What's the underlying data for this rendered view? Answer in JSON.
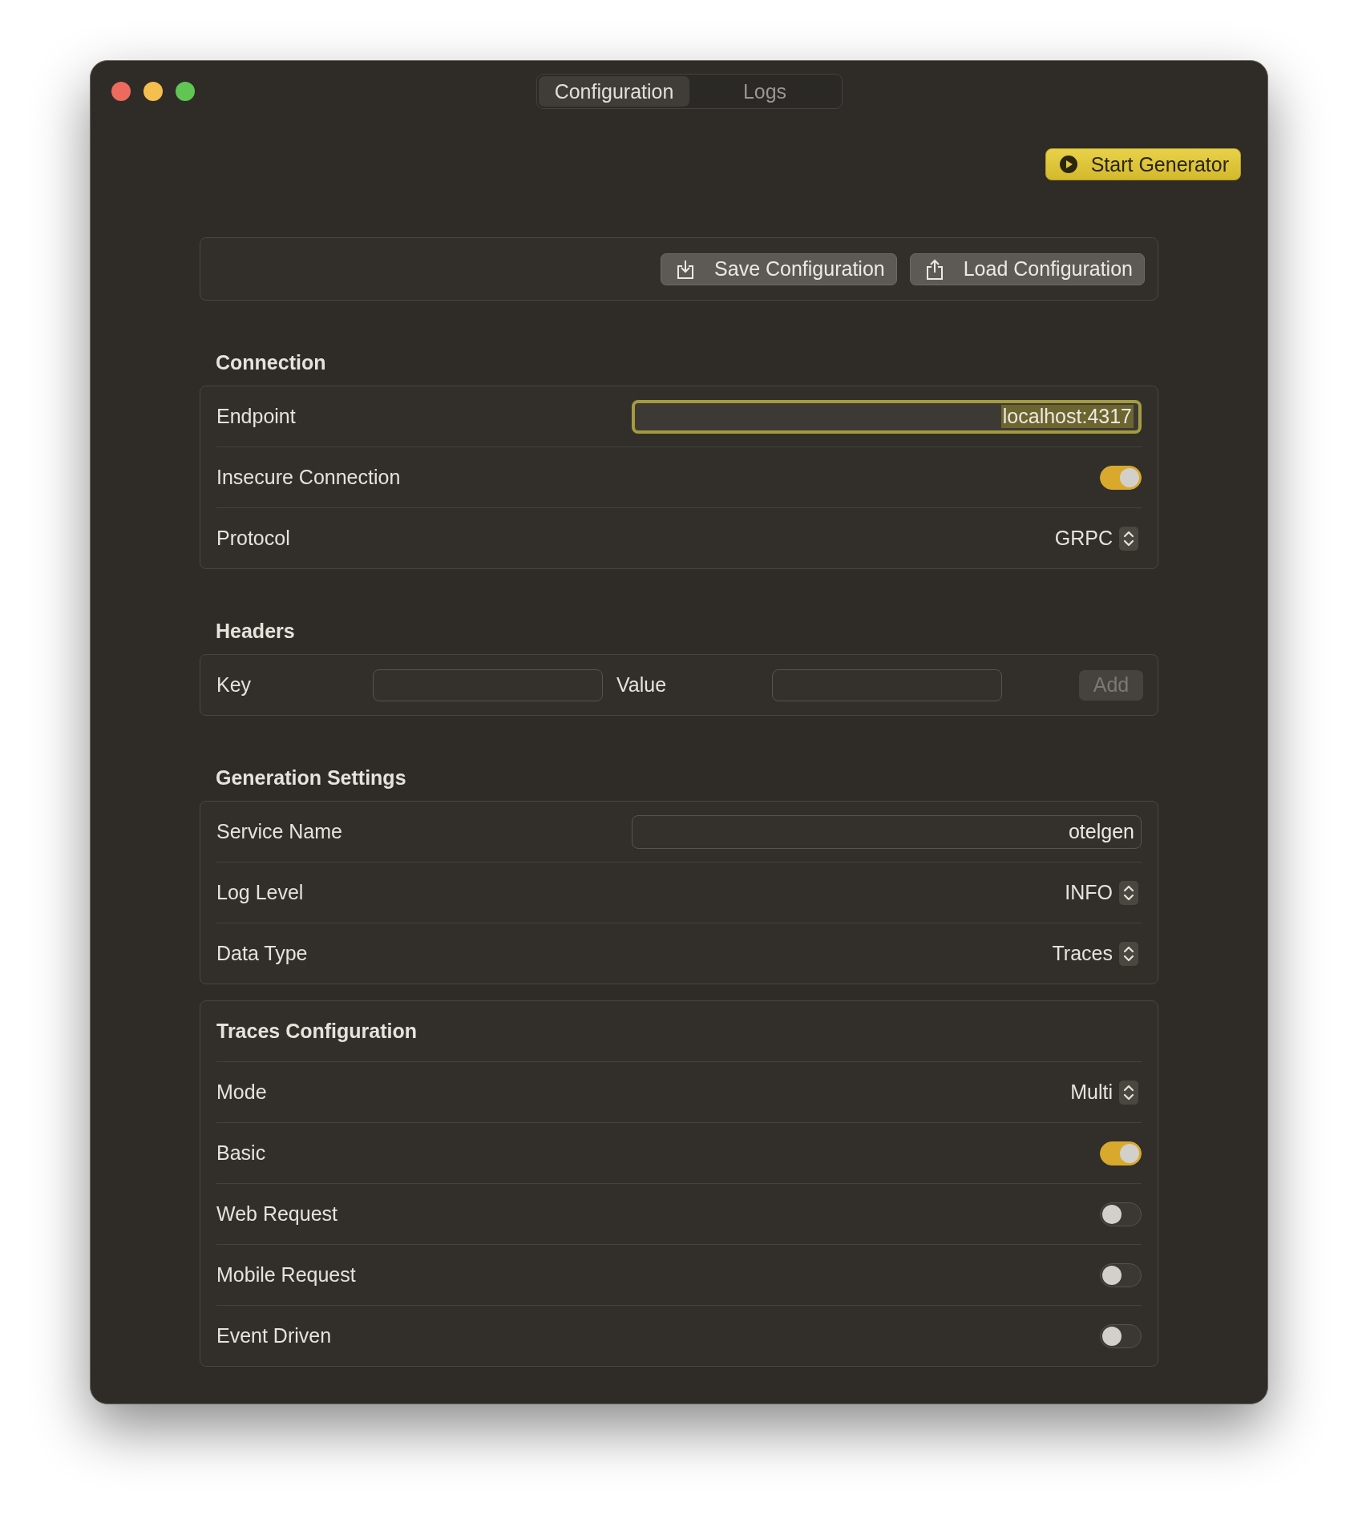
{
  "window": {
    "tabs": [
      {
        "label": "Configuration",
        "selected": true
      },
      {
        "label": "Logs",
        "selected": false
      }
    ]
  },
  "start_button": {
    "label": "Start Generator"
  },
  "toolbar": {
    "buttons": [
      {
        "label": "Save Configuration",
        "kind": "save"
      },
      {
        "label": "Load Configuration",
        "kind": "load"
      }
    ]
  },
  "connection": {
    "title": "Connection",
    "rows": [
      {
        "kind": "text",
        "label": "Endpoint",
        "value": "localhost:4317",
        "focused": true
      },
      {
        "kind": "toggle",
        "label": "Insecure Connection",
        "on": true
      },
      {
        "kind": "select",
        "label": "Protocol",
        "value": "GRPC"
      }
    ]
  },
  "headers": {
    "title": "Headers",
    "key_label": "Key",
    "value_label": "Value",
    "add_button": {
      "label": "Add",
      "disabled": true
    }
  },
  "generation": {
    "title": "Generation Settings",
    "rows": [
      {
        "kind": "text",
        "label": "Service Name",
        "value": "otelgen",
        "focused": false
      },
      {
        "kind": "select",
        "label": "Log Level",
        "value": "INFO"
      },
      {
        "kind": "select",
        "label": "Data Type",
        "value": "Traces"
      }
    ]
  },
  "traces": {
    "title": "Traces Configuration",
    "rows": [
      {
        "kind": "select",
        "label": "Mode",
        "value": "Multi"
      },
      {
        "kind": "toggle",
        "label": "Basic",
        "on": true
      },
      {
        "kind": "toggle",
        "label": "Web Request",
        "on": false
      },
      {
        "kind": "toggle",
        "label": "Mobile Request",
        "on": false
      },
      {
        "kind": "toggle",
        "label": "Event Driven",
        "on": false
      }
    ]
  }
}
